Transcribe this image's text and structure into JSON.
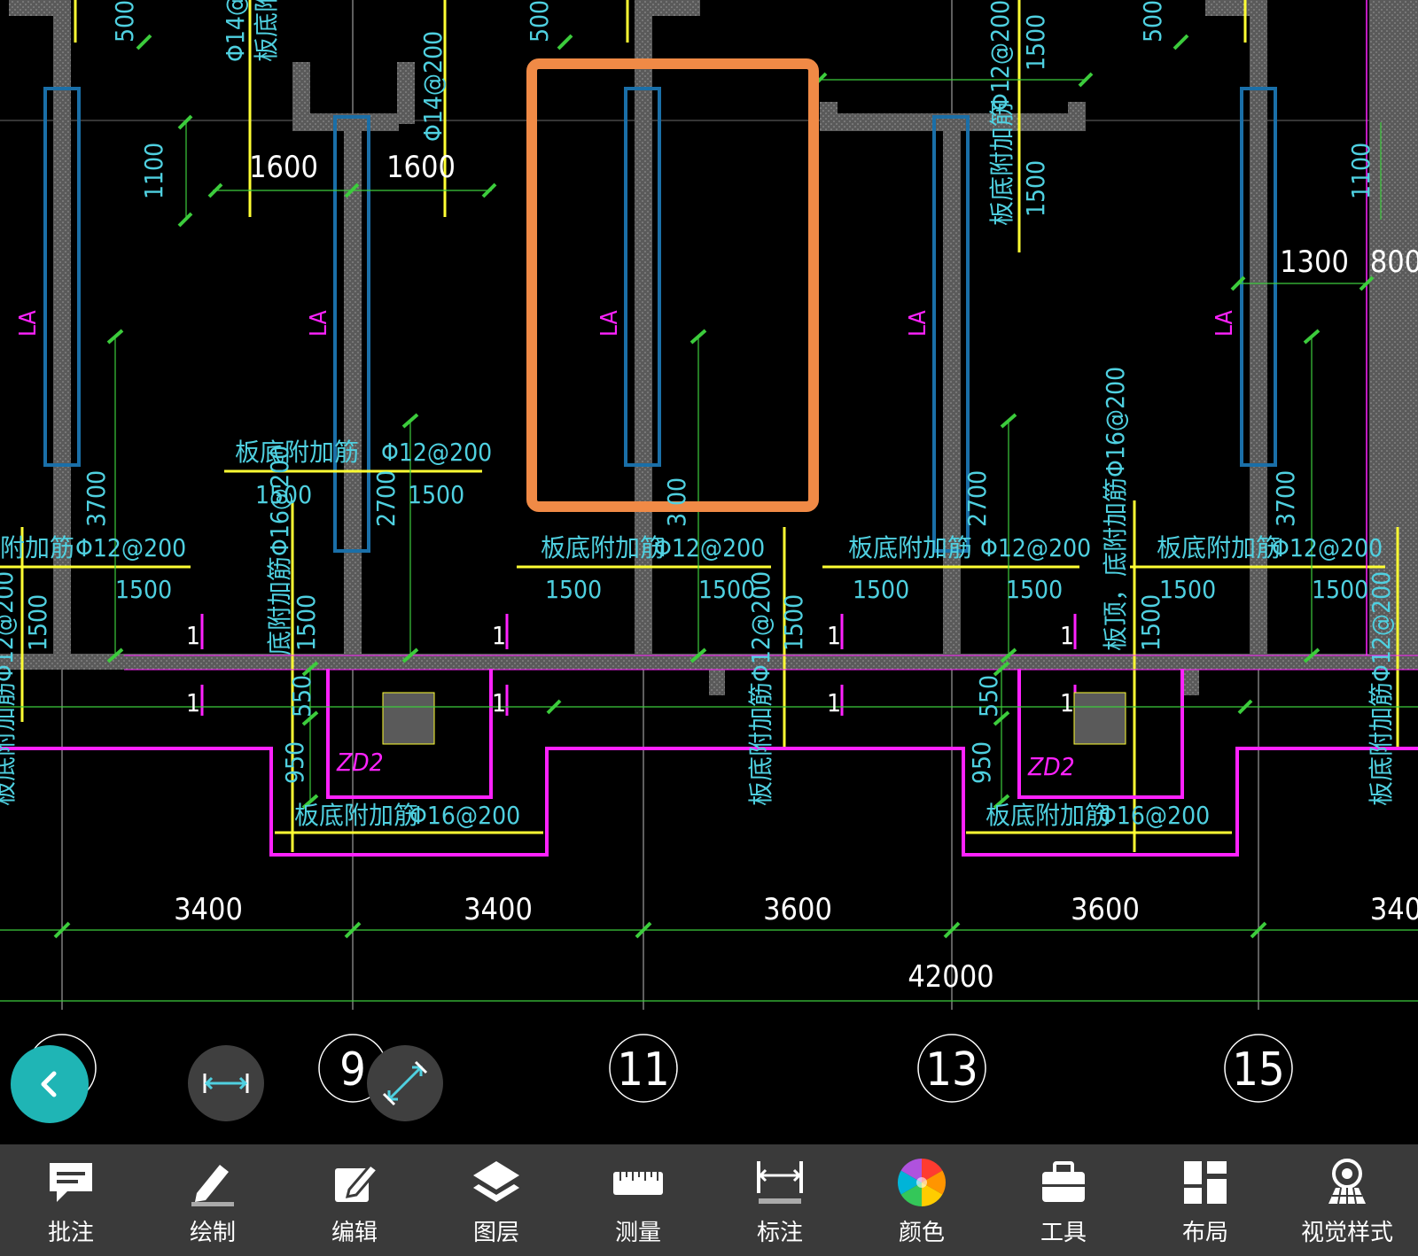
{
  "drawing": {
    "dimensions_bottom": [
      "3400",
      "3400",
      "3600",
      "3600",
      "340"
    ],
    "total_dimension": "42000",
    "axis_labels": [
      "9",
      "11",
      "13",
      "15"
    ],
    "rebar_label": "板底附加筋",
    "rebar_spec_12": "Φ12@200",
    "rebar_spec_16": "Φ16@200",
    "rebar_spec_14": "Φ14@200",
    "len_1500": "1500",
    "len_1600": "1600",
    "len_1100": "1100",
    "len_1300": "1300",
    "len_800": "800",
    "len_3700": "3700",
    "len_2700": "2700",
    "len_500": "500",
    "len_550": "550",
    "len_950": "950",
    "len_3_00": "3 00",
    "wall_tag": "LA",
    "pit_tag": "ZD2",
    "section_mark": "1",
    "vertical_note_top": "板顶，底附加筋Φ16@200",
    "vertical_note_side": "底附加筋Φ16@200",
    "vertical_note_bottom": "板底附加筋Φ12@200",
    "note_partial": "附加筋",
    "note_partial_left": "板底附",
    "note_partial_ban": "板底附加筋"
  },
  "toolbar": {
    "items": [
      {
        "label": "批注",
        "icon": "comment-icon"
      },
      {
        "label": "绘制",
        "icon": "pen-icon"
      },
      {
        "label": "编辑",
        "icon": "edit-icon"
      },
      {
        "label": "图层",
        "icon": "layers-icon"
      },
      {
        "label": "测量",
        "icon": "ruler-icon"
      },
      {
        "label": "标注",
        "icon": "dimension-icon"
      },
      {
        "label": "颜色",
        "icon": "color-wheel-icon"
      },
      {
        "label": "工具",
        "icon": "toolbox-icon"
      },
      {
        "label": "布局",
        "icon": "layout-icon"
      },
      {
        "label": "视觉样式",
        "icon": "visual-style-icon"
      }
    ]
  },
  "colors": {
    "wall": "#7a7a7a",
    "cyan_text": "#4fd0e0",
    "yellow": "#ffff33",
    "green": "#3ccc3c",
    "magenta": "#ff22ff",
    "blue_box": "#1a6fa8",
    "highlight": "#f08a46",
    "fab_teal": "#1fb5b5"
  }
}
